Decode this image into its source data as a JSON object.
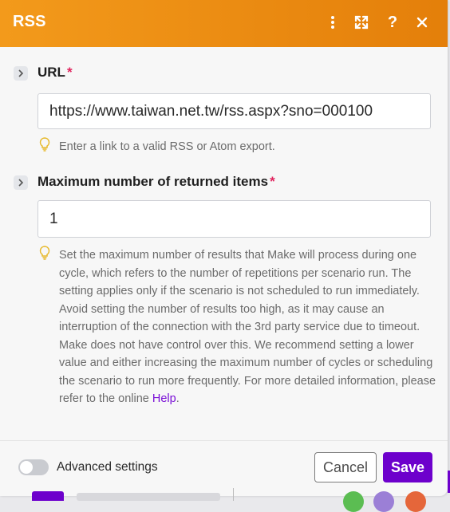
{
  "header": {
    "title": "RSS",
    "bg_start": "#f39a1b",
    "bg_end": "#e47f0a",
    "icons": [
      "more-vertical-icon",
      "expand-icon",
      "help-icon",
      "close-icon"
    ]
  },
  "fields": {
    "url": {
      "label": "URL",
      "required_mark": "*",
      "value": "https://www.taiwan.net.tw/rss.aspx?sno=000100",
      "hint": "Enter a link to a valid RSS or Atom export."
    },
    "max_items": {
      "label": "Maximum number of returned items",
      "required_mark": "*",
      "value": "1",
      "hint": "Set the maximum number of results that Make will process during one cycle, which refers to the number of repetitions per scenario run. The setting applies only if the scenario is not scheduled to run immediately. Avoid setting the number of results too high, as it may cause an interruption of the connection with the 3rd party service due to timeout. Make does not have control over this. We recommend setting a lower value and either increasing the maximum number of cycles or scheduling the scenario to run more frequently. For more detailed information, please refer to the online",
      "hint_link": "Help",
      "hint_end": "."
    }
  },
  "footer": {
    "advanced_label": "Advanced settings",
    "advanced_enabled": false,
    "cancel_label": "Cancel",
    "save_label": "Save",
    "accent": "#6d00cc"
  }
}
